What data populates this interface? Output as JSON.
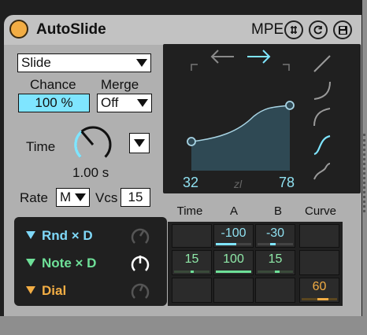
{
  "header": {
    "title": "AutoSlide",
    "mpe_label": "MPE",
    "icons": [
      "power-icon",
      "in-out-icon",
      "reset-icon",
      "save-icon"
    ]
  },
  "controls": {
    "mode_select": "Slide",
    "chance_label": "Chance",
    "chance_value": "100 %",
    "merge_label": "Merge",
    "merge_select": "Off",
    "time_label": "Time",
    "time_value": "1.00 s",
    "time_knob_level": 0.35,
    "rate_label": "Rate",
    "rate_select": "M",
    "vcs_label": "Vcs",
    "vcs_value": "15"
  },
  "curve_panel": {
    "start_value": "32",
    "end_value": "78",
    "center_glyph": "zl",
    "curve_shapes": [
      "linear-shape-icon",
      "log-shape-icon",
      "exp-shape-icon",
      "s-shape-icon",
      "wave-shape-icon"
    ],
    "selected_shape_index": 3
  },
  "routing": {
    "rows": [
      {
        "label": "Rnd × D",
        "color": "#7fd8f8"
      },
      {
        "label": "Note × D",
        "color": "#6ee098"
      },
      {
        "label": "Dial",
        "color": "#f2ad44"
      }
    ]
  },
  "matrix": {
    "headers": [
      "Time",
      "A",
      "B",
      "Curve"
    ],
    "values": {
      "r1_a": "-100",
      "r1_b": "-30",
      "r2_time": "15",
      "r2_a": "100",
      "r2_b": "15",
      "r3_curve": "60"
    }
  },
  "colors": {
    "accent_cyan": "#7fe5ff",
    "accent_green": "#6ee098",
    "accent_orange": "#f2ad44",
    "panel_dark": "#202020"
  }
}
